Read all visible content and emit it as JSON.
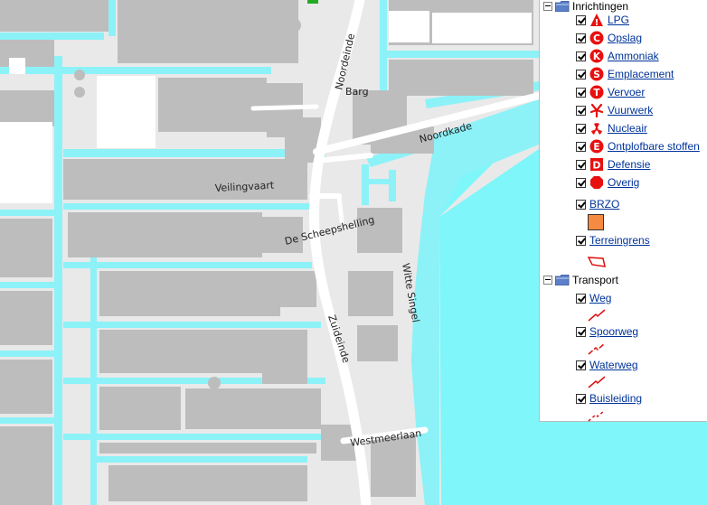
{
  "map": {
    "streets": {
      "noordeinde": "Noordeinde",
      "barg": "Barg",
      "noordkade": "Noordkade",
      "veilingvaart": "Veilingvaart",
      "scheepshelling": "De Scheepshelling",
      "witte_singel": "Witte Singel",
      "zuideinde": "Zuideinde",
      "westmeerlaan": "Westmeerlaan"
    },
    "colors": {
      "water": "#8cf2f8",
      "sea": "#7ef6fa",
      "land": "#e9e9e9",
      "building": "#bdbdbd",
      "road": "#ffffff"
    }
  },
  "legend": {
    "inrichtingen": {
      "label": "Inrichtingen",
      "items": [
        {
          "label": "LPG",
          "icon": "warning-triangle-icon",
          "letter": "!"
        },
        {
          "label": "Opslag",
          "icon": "letter-c-circle-icon",
          "letter": "C"
        },
        {
          "label": "Ammoniak",
          "icon": "letter-k-circle-icon",
          "letter": "K"
        },
        {
          "label": "Emplacement",
          "icon": "letter-s-circle-icon",
          "letter": "S"
        },
        {
          "label": "Vervoer",
          "icon": "letter-t-circle-icon",
          "letter": "T"
        },
        {
          "label": "Vuurwerk",
          "icon": "fireworks-icon",
          "letter": ""
        },
        {
          "label": "Nucleair",
          "icon": "radiation-icon",
          "letter": ""
        },
        {
          "label": "Ontplofbare stoffen",
          "icon": "letter-e-circle-icon",
          "letter": "E"
        },
        {
          "label": "Defensie",
          "icon": "letter-d-square-icon",
          "letter": "D"
        },
        {
          "label": "Overig",
          "icon": "red-octagon-icon",
          "letter": ""
        }
      ],
      "brzo": "BRZO",
      "terreingrens": "Terreingrens"
    },
    "transport": {
      "label": "Transport",
      "items": [
        {
          "label": "Weg"
        },
        {
          "label": "Spoorweg"
        },
        {
          "label": "Waterweg"
        },
        {
          "label": "Buisleiding"
        }
      ]
    },
    "colors": {
      "link": "#00339a",
      "icon_red": "#e8100f",
      "brzo_fill": "#f58a42"
    }
  }
}
